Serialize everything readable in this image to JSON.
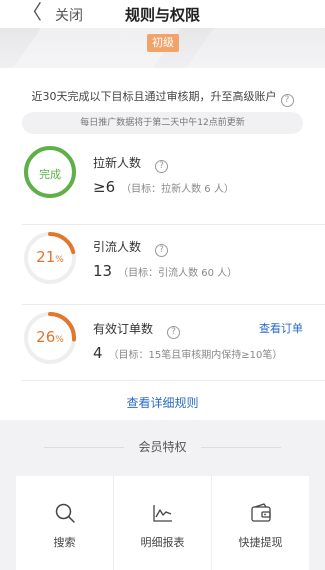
{
  "nav": {
    "back_glyph": "〈",
    "close_label": "关闭",
    "title": "规则与权限"
  },
  "level_badge": "初级",
  "intro": {
    "text": "近30天完成以下目标且通过审核期，升至高级账户",
    "help_glyph": "?"
  },
  "notice": "每日推广数据将于第二天中午12点前更新",
  "metrics": [
    {
      "ring_label": "完成",
      "name": "拉新人数",
      "help_glyph": "?",
      "value": "≥6",
      "target": "（目标：拉新人数 6 人）",
      "progress": 1.0,
      "color": "#5fb04a"
    },
    {
      "ring_label": "21",
      "ring_unit": "%",
      "name": "引流人数",
      "help_glyph": "?",
      "value": "13",
      "target": "（目标：引流人数 60 人）",
      "progress": 0.21,
      "color": "#e1762c"
    },
    {
      "ring_label": "26",
      "ring_unit": "%",
      "name": "有效订单数",
      "help_glyph": "?",
      "value": "4",
      "target": "（目标：15笔且审核期内保持≥10笔）",
      "link": "查看订单",
      "progress": 0.26,
      "color": "#e1762c"
    }
  ],
  "detail_link": "查看详细规则",
  "privileges": {
    "title": "会员特权",
    "items": [
      {
        "icon": "search-icon",
        "label": "搜索"
      },
      {
        "icon": "report-chart-icon",
        "label": "明细报表"
      },
      {
        "icon": "wallet-icon",
        "label": "快捷提现"
      }
    ]
  },
  "colors": {
    "accent_link": "#2a6cc7",
    "progress_orange": "#e1762c",
    "complete_green": "#5fb04a",
    "badge_orange": "#f2a36a"
  }
}
